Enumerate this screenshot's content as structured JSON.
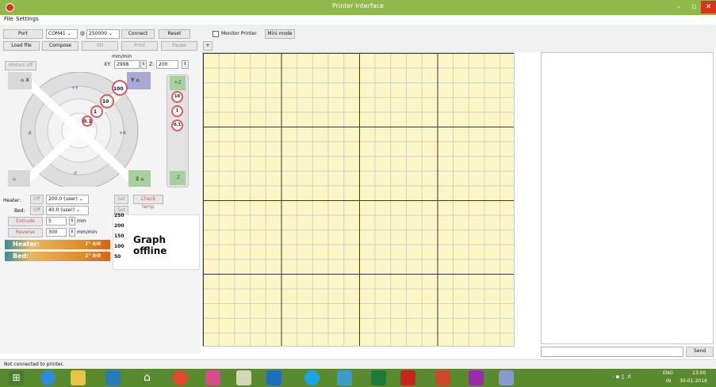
{
  "window": {
    "title": "Printer Interface",
    "minimize": "–",
    "maximize": "▫",
    "close": "✕",
    "icon": "printer-app-icon"
  },
  "menu": {
    "items": [
      "File",
      "Settings"
    ]
  },
  "toolbar": {
    "port_label": "Port",
    "port_value": "COM41",
    "at": "@",
    "baud_value": "250000",
    "connect_label": "Connect",
    "reset_label": "Reset",
    "monitor_label": "Monitor Printer",
    "mini_mode_label": "Mini mode",
    "load_file_label": "Load file",
    "compose_label": "Compose",
    "sd_label": "SD",
    "print_label": "Print",
    "pause_label": "Pause",
    "add_tab_label": "+"
  },
  "controls": {
    "motors_off_label": "Motors off",
    "feed_unit": "mm/min",
    "xy_label": "XY:",
    "xy_value": "2998",
    "z_label": "Z:",
    "z_value": "200",
    "jog_labels": {
      "home_x": "X",
      "plus_y": "+Y",
      "home_y": "Y",
      "minus_x": "-X",
      "plus_x": "+X",
      "minus_y": "-Y",
      "home_z": "Z",
      "home_all": ""
    },
    "xy_steps": [
      "100",
      "10",
      "1",
      "0.1"
    ],
    "z_labels": {
      "plus_z": "+Z",
      "minus_z": "-Z"
    },
    "z_steps": [
      "10",
      "1",
      "0.1"
    ]
  },
  "temps": {
    "heater_label": "Heater:",
    "heater_off": "Off",
    "heater_value": "200.0 (user)",
    "heater_set": "Set",
    "check_temp_label": "Check temp",
    "bed_label": "Bed:",
    "bed_off": "Off",
    "bed_value": "40.0 (user)",
    "bed_set": "Set"
  },
  "extrude": {
    "extrude_label": "Extrude",
    "length_value": "5",
    "length_unit": "mm",
    "reverse_label": "Reverse",
    "speed_value": "300",
    "speed_unit": "mm/min"
  },
  "gauges": {
    "heater_label": "Heater:",
    "heater_value": "1° 0/0",
    "bed_label": "Bed:",
    "bed_value": "1° 0/0"
  },
  "graph": {
    "offline_text": "Graph offline",
    "y_ticks": [
      "250",
      "200",
      "150",
      "100",
      "50"
    ]
  },
  "console": {
    "send_label": "Send"
  },
  "status": {
    "text": "Not connected to printer."
  },
  "taskbar": {
    "icons": [
      "start-icon",
      "internet-explorer-icon",
      "file-explorer-icon",
      "monitor-icon",
      "home-icon",
      "chrome-icon",
      "paint-icon",
      "notepad-icon",
      "outlook-icon",
      "skype-icon",
      "photos-icon",
      "excel-icon",
      "acrobat-icon",
      "powerpoint-icon",
      "app-icon",
      "pronterface-icon"
    ],
    "lang": "ENG",
    "region": "IN",
    "time": "23:00",
    "date": "30-01-2016"
  },
  "colors": {
    "titlebar": "#8fb94b",
    "grid_bg": "#fbf6c5",
    "taskbar": "#5a8a2e",
    "heater_bar": "#e08a2a",
    "step_ring": "#e05a5a"
  }
}
